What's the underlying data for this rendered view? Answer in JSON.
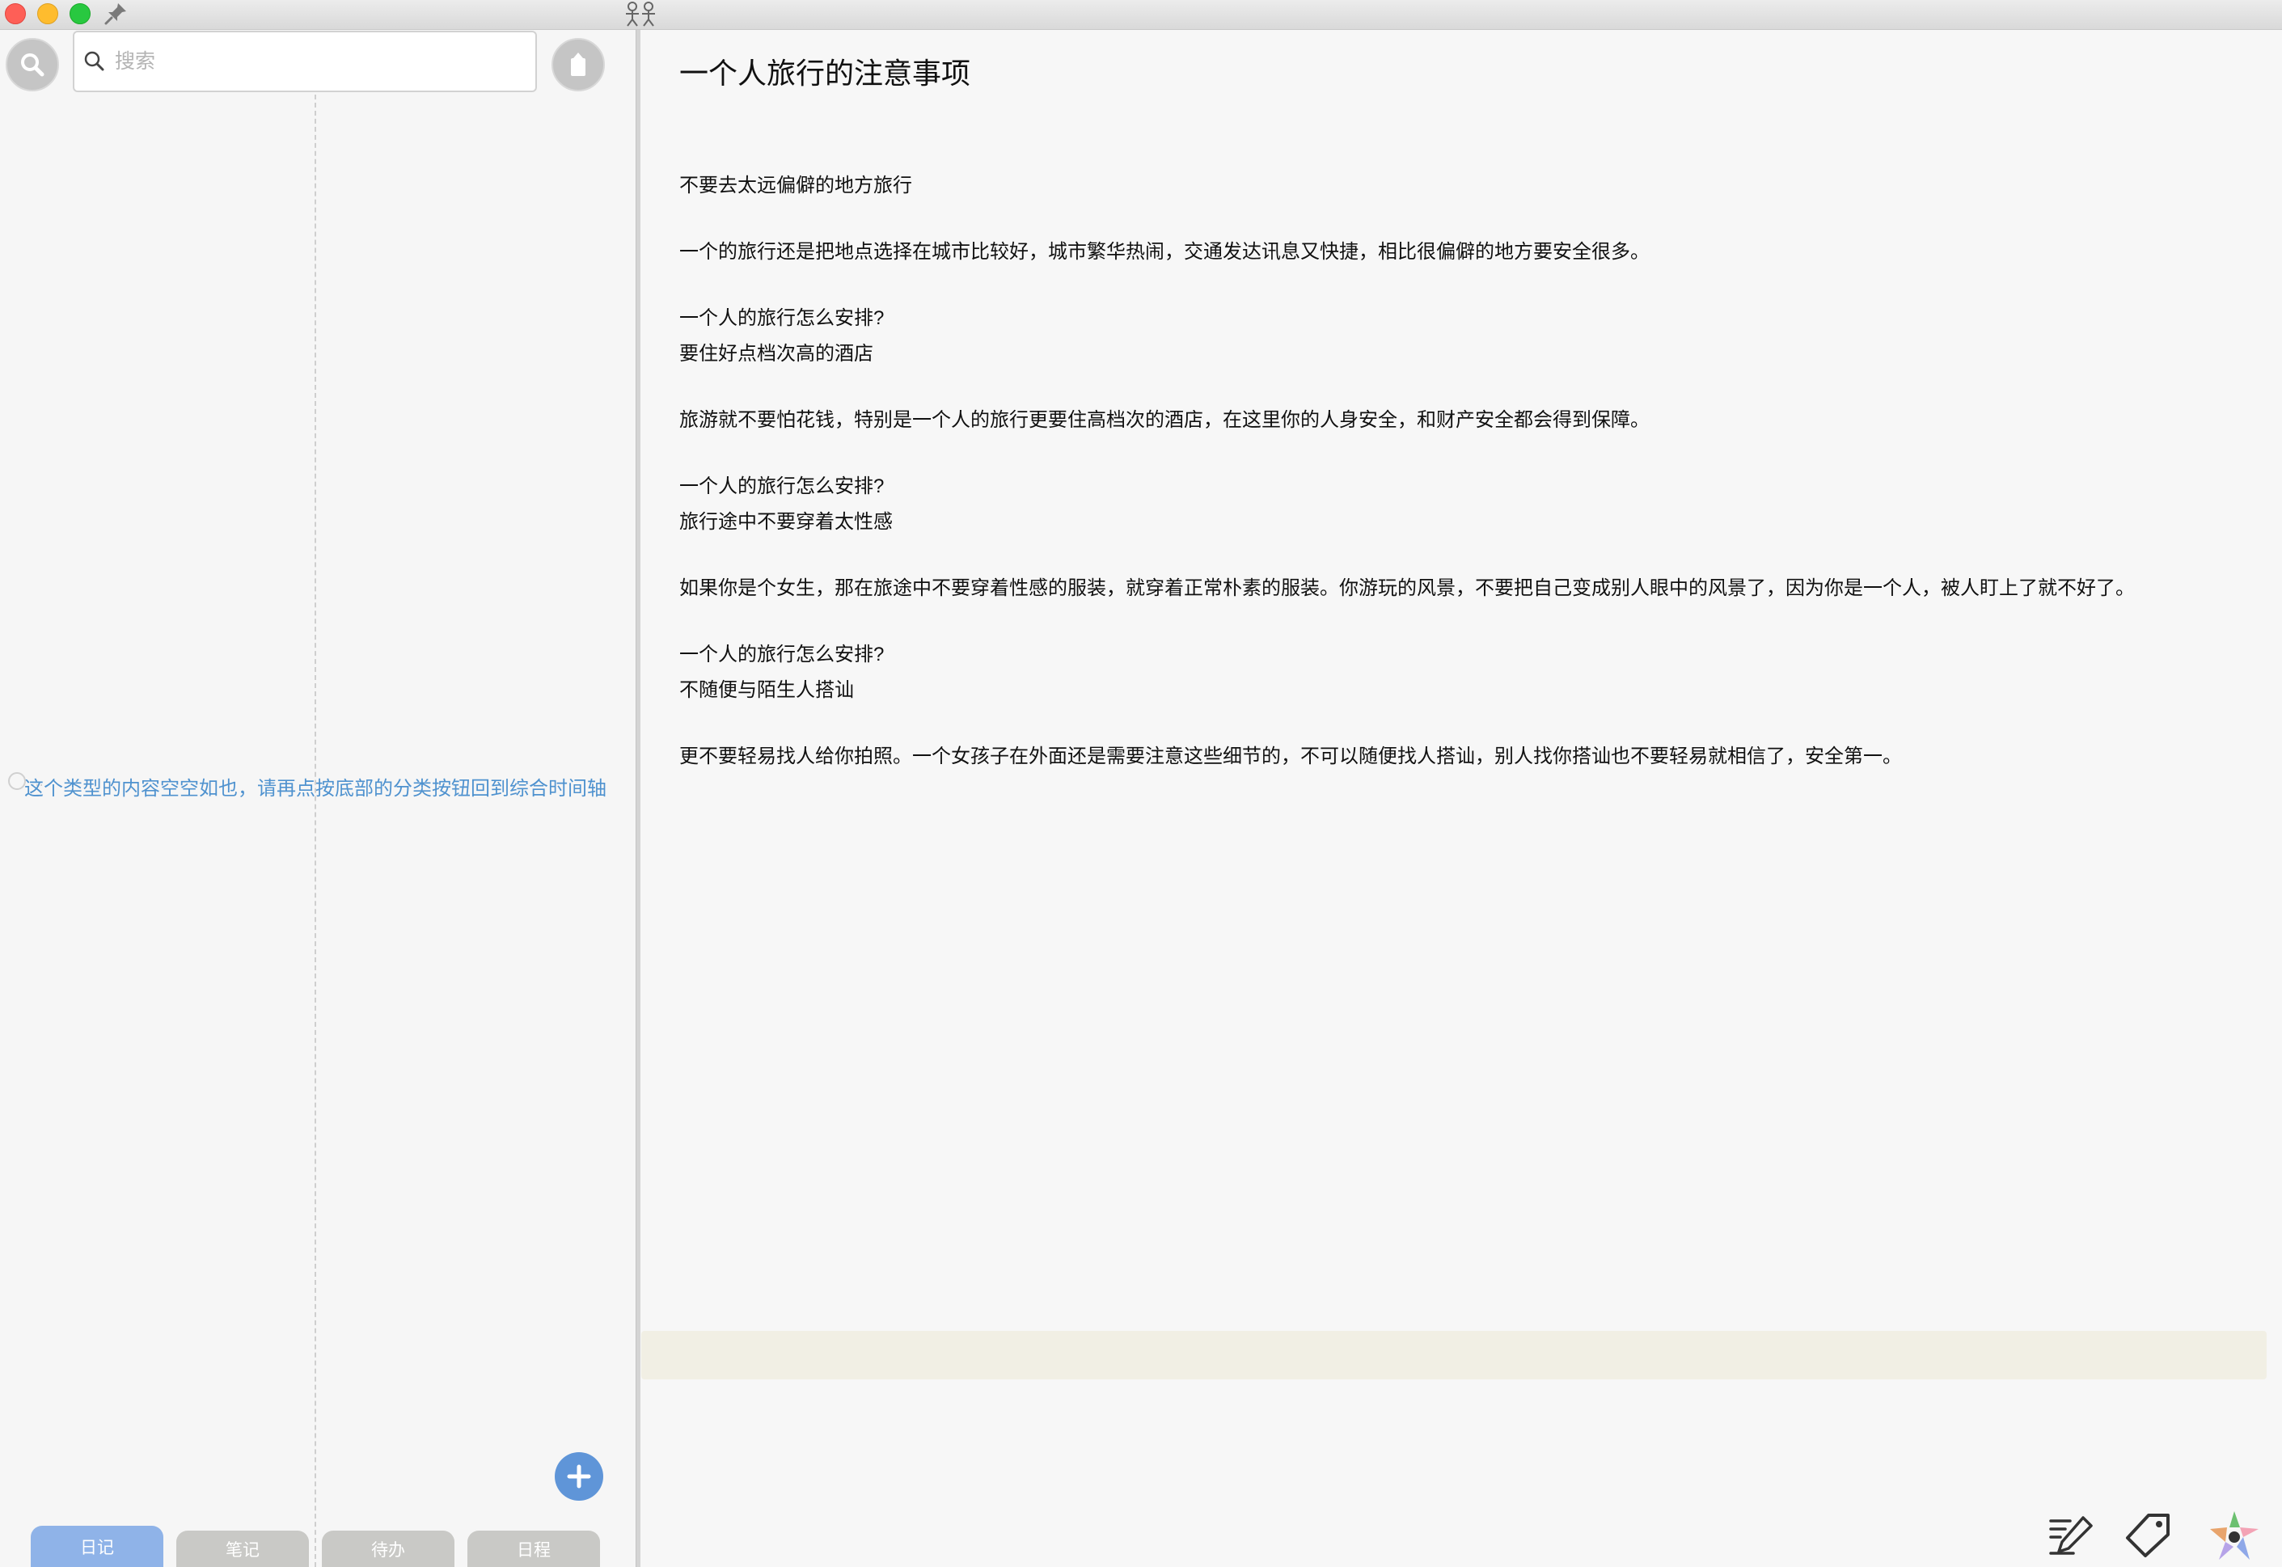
{
  "window": {
    "controls": [
      "close",
      "minimize",
      "zoom"
    ],
    "pin_icon": "pin-icon",
    "app_icon": "app-logo-icon"
  },
  "sidebar": {
    "search_placeholder": "搜索",
    "empty_message": "这个类型的内容空空如也，请再点按底部的分类按钮回到综合时间轴",
    "ghost_label": "...",
    "tabs": [
      {
        "label": "日记",
        "active": true
      },
      {
        "label": "笔记",
        "active": false
      },
      {
        "label": "待办",
        "active": false
      },
      {
        "label": "日程",
        "active": false
      }
    ],
    "accent_color": "#4f92cf"
  },
  "document": {
    "title": "一个人旅行的注意事项",
    "paragraphs": [
      "不要去太远偏僻的地方旅行",
      "一个的旅行还是把地点选择在城市比较好，城市繁华热闹，交通发达讯息又快捷，相比很偏僻的地方要安全很多。",
      "一个人的旅行怎么安排?",
      "要住好点档次高的酒店",
      "旅游就不要怕花钱，特别是一个人的旅行更要住高档次的酒店，在这里你的人身安全，和财产安全都会得到保障。",
      "一个人的旅行怎么安排?",
      "旅行途中不要穿着太性感",
      "如果你是个女生，那在旅途中不要穿着性感的服装，就穿着正常朴素的服装。你游玩的风景，不要把自己变成别人眼中的风景了，因为你是一个人，被人盯上了就不好了。",
      "一个人的旅行怎么安排?",
      "不随便与陌生人搭讪",
      "更不要轻易找人给你拍照。一个女孩子在外面还是需要注意这些细节的，不可以随便找人搭讪，别人找你搭讪也不要轻易就相信了，安全第一。"
    ]
  },
  "toolbar": {
    "icons": [
      "edit-icon",
      "tag-icon",
      "color-star-icon"
    ]
  }
}
